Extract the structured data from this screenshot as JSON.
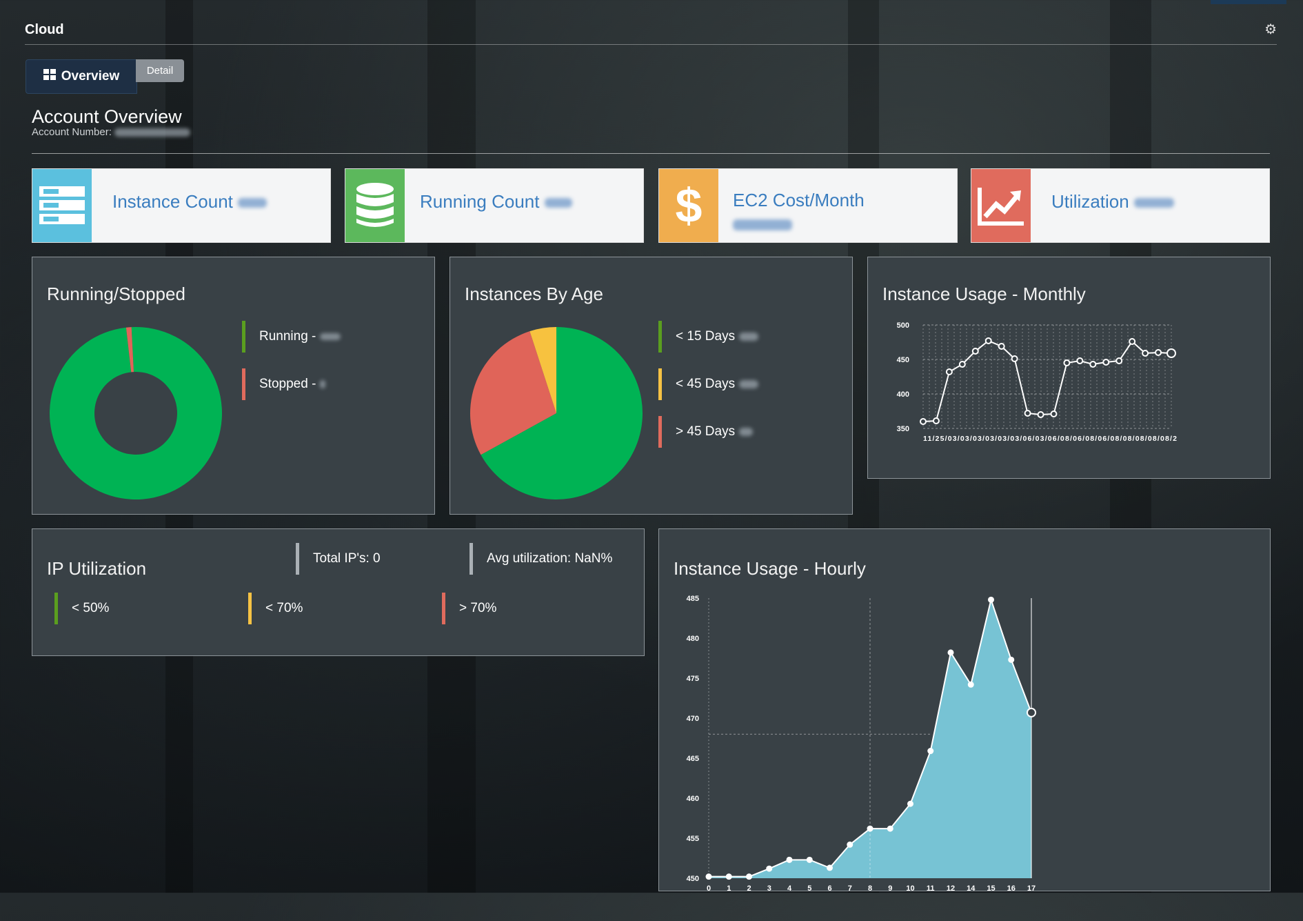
{
  "app": {
    "title": "Cloud",
    "settings_icon": "gear-icon"
  },
  "tabs": [
    {
      "label": "Overview",
      "icon": "grid-icon",
      "active": true
    },
    {
      "label": "Detail",
      "active": false
    }
  ],
  "account": {
    "title": "Account Overview",
    "number_label": "Account Number:"
  },
  "stats": [
    {
      "label": "Instance Count",
      "icon": "server-icon",
      "color": "#5bc0de"
    },
    {
      "label": "Running Count",
      "icon": "database-icon",
      "color": "#5cb85c"
    },
    {
      "label": "EC2 Cost/Month",
      "icon": "dollar-icon",
      "color": "#f0ad4e"
    },
    {
      "label": "Utilization",
      "icon": "trend-up-icon",
      "color": "#e06b5d"
    }
  ],
  "running_stopped": {
    "title": "Running/Stopped",
    "legend": [
      {
        "label": "Running -",
        "color": "#5a9e1f"
      },
      {
        "label": "Stopped -",
        "color": "#e06b5d"
      }
    ]
  },
  "instances_by_age": {
    "title": "Instances By Age",
    "legend": [
      {
        "label": "< 15 Days",
        "color": "#5a9e1f"
      },
      {
        "label": "< 45 Days",
        "color": "#f6c244"
      },
      {
        "label": "> 45 Days",
        "color": "#e06b5d"
      }
    ]
  },
  "ip_utilization": {
    "title": "IP Utilization",
    "total": "Total IP's: 0",
    "avg": "Avg utilization: NaN%",
    "legend": [
      {
        "label": "< 50%",
        "color": "#5a9e1f"
      },
      {
        "label": "< 70%",
        "color": "#f6c244"
      },
      {
        "label": "> 70%",
        "color": "#e06b5d"
      }
    ]
  },
  "monthly_title": "Instance Usage - Monthly",
  "hourly_title": "Instance Usage - Hourly",
  "colors": {
    "green": "#00b354",
    "red": "#e06459",
    "yellow": "#f7c23f",
    "area": "#77c3d4"
  },
  "chart_data": [
    {
      "type": "pie",
      "donut": true,
      "slices": [
        {
          "label": "Running",
          "value": 99,
          "color": "#00b354"
        },
        {
          "label": "Stopped",
          "value": 1,
          "color": "#e06459"
        }
      ]
    },
    {
      "type": "pie",
      "slices": [
        {
          "label": "< 15 Days",
          "value": 67,
          "color": "#00b354"
        },
        {
          "label": "> 45 Days",
          "value": 28,
          "color": "#e06459"
        },
        {
          "label": "< 45 Days",
          "value": 5,
          "color": "#f7c23f"
        }
      ]
    },
    {
      "type": "line",
      "ylim": [
        350,
        500
      ],
      "yticks": [
        350,
        400,
        450,
        500
      ],
      "xtick_text": "11/25/03/03/03/03/03/03/06/03/06/08/06/08/06/08/08/08/08/08/2",
      "values": [
        360,
        361,
        432,
        443,
        462,
        477,
        469,
        451,
        372,
        370,
        371,
        445,
        448,
        443,
        446,
        448,
        476,
        459,
        460,
        459
      ],
      "grid": true
    },
    {
      "type": "area",
      "ylim": [
        450,
        485
      ],
      "yticks": [
        450,
        455,
        460,
        465,
        470,
        475,
        480,
        485
      ],
      "xticks": [
        "0",
        "1",
        "2",
        "3",
        "4",
        "5",
        "6",
        "7",
        "8",
        "9",
        "10",
        "11",
        "12",
        "14",
        "15",
        "16",
        "17"
      ],
      "x": [
        0,
        1,
        2,
        3,
        4,
        5,
        6,
        7,
        8,
        9,
        10,
        11,
        12,
        13,
        14,
        15,
        16
      ],
      "values": [
        450.2,
        450.2,
        450.2,
        451.2,
        452.3,
        452.3,
        451.3,
        454.2,
        456.2,
        456.2,
        459.3,
        465.9,
        478.2,
        474.2,
        484.8,
        477.3,
        470.7
      ],
      "crosshair": {
        "x": 8,
        "y": 468
      }
    }
  ]
}
